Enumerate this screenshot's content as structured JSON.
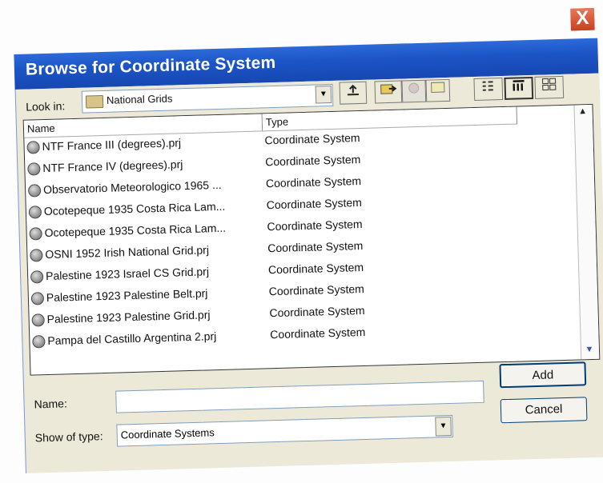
{
  "window": {
    "title": "Browse for Coordinate System",
    "close_label": "X"
  },
  "lookin": {
    "label": "Look in:",
    "value": "National Grids",
    "arrow": "▼"
  },
  "toolbar": {
    "up_icon": "folder-up-icon",
    "connect_icon": "connect-folder-icon",
    "disconnect_icon": "disconnect-icon",
    "home_icon": "home-folder-icon",
    "list_icon": "list-view-icon",
    "details_icon": "details-view-icon",
    "thumbs_icon": "thumbnails-view-icon"
  },
  "list": {
    "columns": [
      "Name",
      "Type"
    ],
    "rows": [
      {
        "name": "NTF France III (degrees).prj",
        "type": "Coordinate System"
      },
      {
        "name": "NTF France IV (degrees).prj",
        "type": "Coordinate System"
      },
      {
        "name": "Observatorio Meteorologico 1965 ...",
        "type": "Coordinate System"
      },
      {
        "name": "Ocotepeque 1935 Costa Rica Lam...",
        "type": "Coordinate System"
      },
      {
        "name": "Ocotepeque 1935 Costa Rica Lam...",
        "type": "Coordinate System"
      },
      {
        "name": "OSNI 1952 Irish National Grid.prj",
        "type": "Coordinate System"
      },
      {
        "name": "Palestine 1923 Israel CS Grid.prj",
        "type": "Coordinate System"
      },
      {
        "name": "Palestine 1923 Palestine Belt.prj",
        "type": "Coordinate System"
      },
      {
        "name": "Palestine 1923 Palestine Grid.prj",
        "type": "Coordinate System"
      },
      {
        "name": "Pampa del Castillo Argentina 2.prj",
        "type": "Coordinate System"
      }
    ]
  },
  "name_field": {
    "label": "Name:",
    "value": ""
  },
  "type_field": {
    "label": "Show of type:",
    "value": "Coordinate Systems",
    "arrow": "▼"
  },
  "buttons": {
    "add": "Add",
    "cancel": "Cancel"
  }
}
